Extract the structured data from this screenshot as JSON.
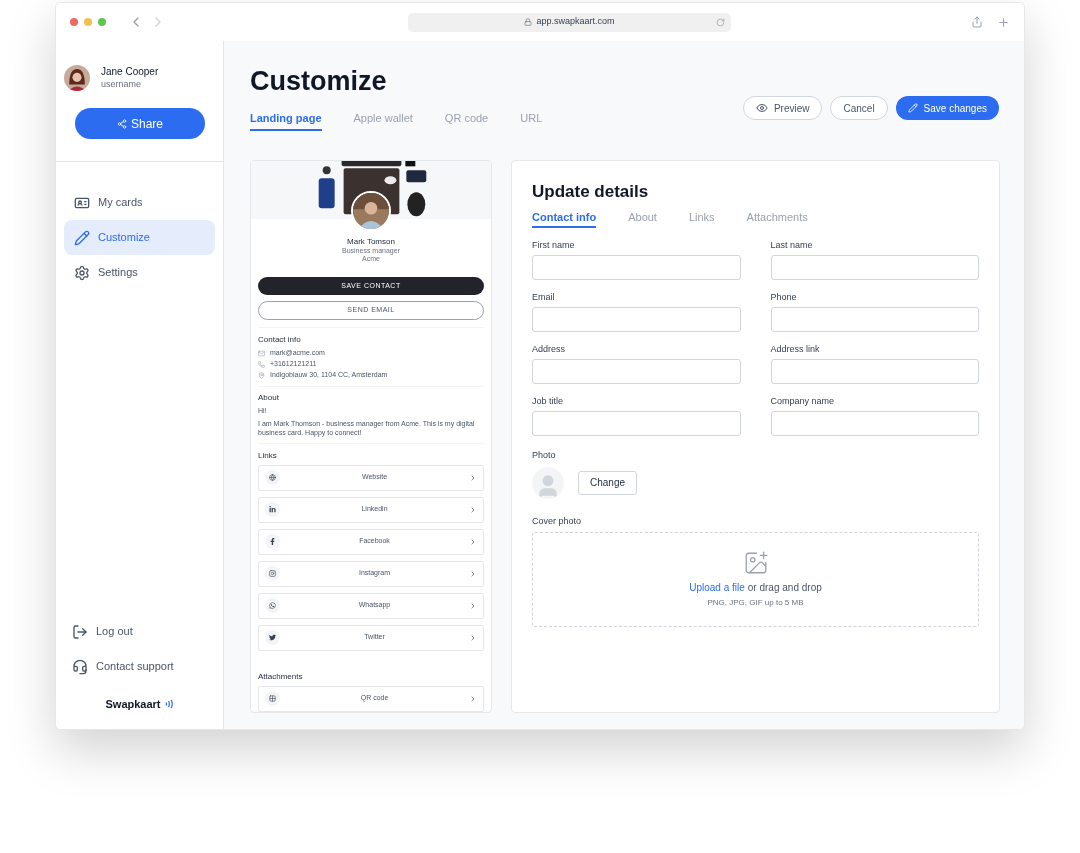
{
  "browser": {
    "url": "app.swapkaart.com"
  },
  "sidebar": {
    "user": {
      "name": "Jane Cooper",
      "username": "username"
    },
    "share": "Share",
    "items": [
      {
        "label": "My cards",
        "kind": "cards",
        "selected": false
      },
      {
        "label": "Customize",
        "kind": "edit",
        "selected": true
      },
      {
        "label": "Settings",
        "kind": "settings",
        "selected": false
      }
    ],
    "bottom": [
      {
        "label": "Log out",
        "kind": "logout"
      },
      {
        "label": "Contact support",
        "kind": "support"
      }
    ],
    "brand": "Swapkaart"
  },
  "header": {
    "title": "Customize",
    "tabs": [
      {
        "label": "Landing page",
        "selected": true
      },
      {
        "label": "Apple wallet",
        "selected": false
      },
      {
        "label": "QR code",
        "selected": false
      },
      {
        "label": "URL",
        "selected": false
      }
    ],
    "buttons": [
      {
        "label": "Preview",
        "kind": "preview"
      },
      {
        "label": "Cancel",
        "kind": "cancel"
      },
      {
        "label": "Save changes",
        "kind": "save"
      }
    ]
  },
  "preview": {
    "name": "Mark Tomson",
    "role": "Business manager",
    "company": "Acme",
    "save_contact": "SAVE CONTACT",
    "send_email": "SEND EMAIL",
    "contact_title": "Contact info",
    "contact": [
      {
        "kind": "email",
        "text": "mark@acme.com"
      },
      {
        "kind": "phone",
        "text": "+31612121211"
      },
      {
        "kind": "address",
        "text": "Indigoblauw 30, 1104 CC, Amsterdam"
      }
    ],
    "about_title": "About",
    "about_greeting": "Hi!",
    "about_text": "I am Mark Thomson - business manager from Acme. This is my digital business card. Happy to connect!",
    "links_title": "Links",
    "links": [
      {
        "kind": "website",
        "label": "Website"
      },
      {
        "kind": "linkedin",
        "label": "Linkedin"
      },
      {
        "kind": "facebook",
        "label": "Facebook"
      },
      {
        "kind": "instagram",
        "label": "Instagram"
      },
      {
        "kind": "whatsapp",
        "label": "Whatsapp"
      },
      {
        "kind": "twitter",
        "label": "Twitter"
      }
    ],
    "attachments_title": "Attachments",
    "attachments": [
      {
        "kind": "qr",
        "label": "QR code"
      }
    ]
  },
  "form": {
    "title": "Update details",
    "tabs": [
      {
        "label": "Contact info",
        "selected": true
      },
      {
        "label": "About",
        "selected": false
      },
      {
        "label": "Links",
        "selected": false
      },
      {
        "label": "Attachments",
        "selected": false
      }
    ],
    "fields": [
      {
        "label": "First name"
      },
      {
        "label": "Last name"
      },
      {
        "label": "Email"
      },
      {
        "label": "Phone"
      },
      {
        "label": "Address"
      },
      {
        "label": "Address link"
      },
      {
        "label": "Job title"
      },
      {
        "label": "Company name"
      }
    ],
    "photo_label": "Photo",
    "change": "Change",
    "cover_label": "Cover photo",
    "upload_link": "Upload a file",
    "upload_rest": "or drag and drop",
    "upload_hint": "PNG, JPG, GIF up to 5 MB"
  }
}
